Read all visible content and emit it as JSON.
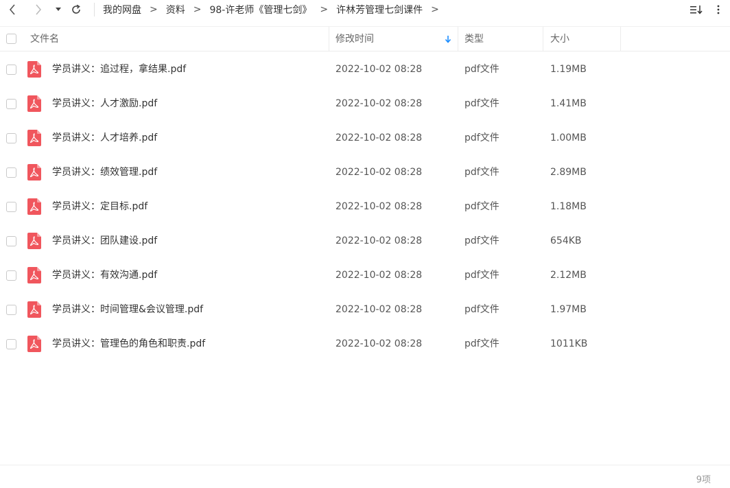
{
  "nav": {
    "back_icon": "chevron-left-icon",
    "forward_icon": "chevron-right-icon",
    "dropdown_icon": "caret-down-icon",
    "refresh_icon": "refresh-icon",
    "breadcrumb": [
      {
        "label": "我的网盘"
      },
      {
        "label": "资料"
      },
      {
        "label": "98-许老师《管理七剑》"
      },
      {
        "label": "许林芳管理七剑课件"
      }
    ],
    "separator": ">",
    "sort_view_icon": "sort-list-icon"
  },
  "columns": {
    "name": "文件名",
    "modified": "修改时间",
    "type": "类型",
    "size": "大小",
    "sort_icon": "arrow-down-icon"
  },
  "files": [
    {
      "name": "学员讲义：追过程，拿结果.pdf",
      "modified": "2022-10-02 08:28",
      "type": "pdf文件",
      "size": "1.19MB"
    },
    {
      "name": "学员讲义：人才激励.pdf",
      "modified": "2022-10-02 08:28",
      "type": "pdf文件",
      "size": "1.41MB"
    },
    {
      "name": "学员讲义：人才培养.pdf",
      "modified": "2022-10-02 08:28",
      "type": "pdf文件",
      "size": "1.00MB"
    },
    {
      "name": "学员讲义：绩效管理.pdf",
      "modified": "2022-10-02 08:28",
      "type": "pdf文件",
      "size": "2.89MB"
    },
    {
      "name": "学员讲义：定目标.pdf",
      "modified": "2022-10-02 08:28",
      "type": "pdf文件",
      "size": "1.18MB"
    },
    {
      "name": "学员讲义：团队建设.pdf",
      "modified": "2022-10-02 08:28",
      "type": "pdf文件",
      "size": "654KB"
    },
    {
      "name": "学员讲义：有效沟通.pdf",
      "modified": "2022-10-02 08:28",
      "type": "pdf文件",
      "size": "2.12MB"
    },
    {
      "name": "学员讲义：时间管理&会议管理.pdf",
      "modified": "2022-10-02 08:28",
      "type": "pdf文件",
      "size": "1.97MB"
    },
    {
      "name": "学员讲义：管理色的角色和职责.pdf",
      "modified": "2022-10-02 08:28",
      "type": "pdf文件",
      "size": "1011KB"
    }
  ],
  "footer": {
    "count": "9项"
  },
  "colors": {
    "pdf_icon": "#f0565d",
    "sort_accent": "#1a8cff"
  }
}
